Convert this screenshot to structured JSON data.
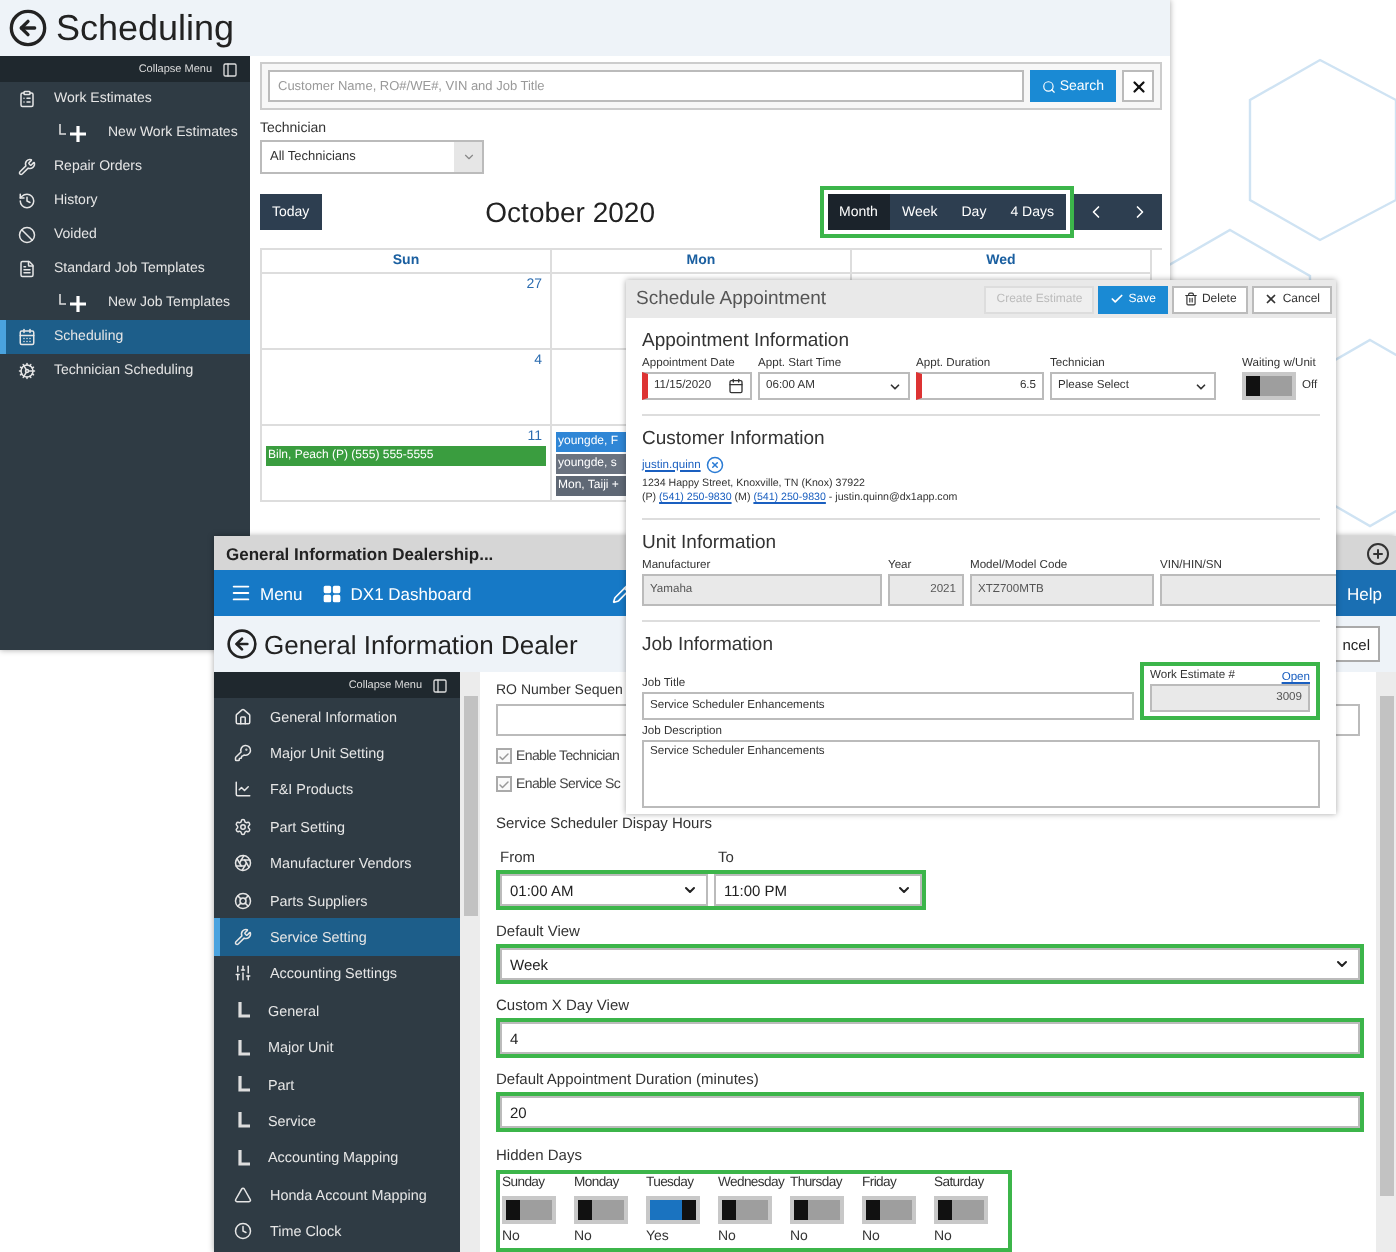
{
  "scheduling_window": {
    "title": "Scheduling",
    "sidebar": {
      "collapse_label": "Collapse Menu",
      "items": [
        {
          "label": "Work Estimates",
          "selected": false,
          "children": [
            {
              "label": "New Work Estimates",
              "selected": false
            }
          ]
        },
        {
          "label": "Repair Orders",
          "selected": false
        },
        {
          "label": "History",
          "selected": false
        },
        {
          "label": "Voided",
          "selected": false
        },
        {
          "label": "Standard Job Templates",
          "selected": false,
          "children": [
            {
              "label": "New Job Templates",
              "selected": false
            }
          ]
        },
        {
          "label": "Scheduling",
          "selected": true
        },
        {
          "label": "Technician Scheduling",
          "selected": false
        }
      ]
    },
    "search": {
      "placeholder": "Customer Name, RO#/WE#, VIN and Job Title",
      "button": "Search"
    },
    "technician": {
      "label": "Technician",
      "value": "All Technicians"
    },
    "today_button": "Today",
    "month_title": "October 2020",
    "view_switcher": {
      "highlighted": true,
      "views": [
        {
          "label": "Month",
          "selected": true
        },
        {
          "label": "Week",
          "selected": false
        },
        {
          "label": "Day",
          "selected": false
        },
        {
          "label": "4 Days",
          "selected": false
        }
      ]
    },
    "calendar": {
      "columns": [
        "Sun",
        "Mon",
        "Wed"
      ],
      "weeks": [
        {
          "sun": {
            "date": "27"
          }
        },
        {
          "sun": {
            "date": "4"
          }
        },
        {
          "sun": {
            "date": "11",
            "events": [
              {
                "text": "Biln, Peach (P) (555) 555-5555",
                "color": "#3a9d3f"
              }
            ]
          },
          "mon": {
            "events": [
              {
                "text": "youngde, F",
                "color": "#2f86d6"
              },
              {
                "text": "youngde, s",
                "color": "#6b7380"
              },
              {
                "text": "Mon, Taiji +",
                "color": "#5f6875"
              }
            ]
          }
        }
      ]
    }
  },
  "general_window": {
    "title": "General Information Dealership...",
    "nav": {
      "menu": "Menu",
      "dashboard": "DX1 Dashboard",
      "help": "Help"
    },
    "heading": "General Information Dealer",
    "cancel_button": "ncel",
    "sidebar": {
      "collapse_label": "Collapse Menu",
      "items": [
        {
          "label": "General Information",
          "selected": false
        },
        {
          "label": "Major Unit Setting",
          "selected": false
        },
        {
          "label": "F&I Products",
          "selected": false
        },
        {
          "label": "Part Setting",
          "selected": false
        },
        {
          "label": "Manufacturer Vendors",
          "selected": false
        },
        {
          "label": "Parts Suppliers",
          "selected": false
        },
        {
          "label": "Service Setting",
          "selected": true
        },
        {
          "label": "Accounting Settings",
          "selected": false,
          "children": [
            {
              "label": "General",
              "selected": false
            },
            {
              "label": "Major Unit",
              "selected": false
            },
            {
              "label": "Part",
              "selected": false
            },
            {
              "label": "Service",
              "selected": false
            },
            {
              "label": "Accounting Mapping",
              "selected": false
            }
          ]
        },
        {
          "label": "Honda Account Mapping",
          "selected": false
        },
        {
          "label": "Time Clock",
          "selected": false
        }
      ]
    },
    "settings": {
      "ro_label": "RO Number Sequen",
      "checkboxes": [
        {
          "label": "Enable Technician",
          "checked": true
        },
        {
          "label": "Enable Service Sc",
          "checked": true
        }
      ],
      "hours": {
        "label": "Service Scheduler Dispay Hours",
        "highlighted": true,
        "from": {
          "label": "From",
          "value": "01:00 AM"
        },
        "to": {
          "label": "To",
          "value": "11:00 PM"
        }
      },
      "default_view": {
        "label": "Default View",
        "value": "Week",
        "highlighted": true
      },
      "custom_days": {
        "label": "Custom X Day View",
        "value": "4",
        "highlighted": true
      },
      "duration": {
        "label": "Default Appointment Duration (minutes)",
        "value": "20",
        "highlighted": true
      },
      "hidden_days": {
        "label": "Hidden Days",
        "highlighted": true,
        "days": [
          {
            "label": "Sunday",
            "on": false,
            "state": "No"
          },
          {
            "label": "Monday",
            "on": false,
            "state": "No"
          },
          {
            "label": "Tuesday",
            "on": true,
            "state": "Yes"
          },
          {
            "label": "Wednesday",
            "on": false,
            "state": "No"
          },
          {
            "label": "Thursday",
            "on": false,
            "state": "No"
          },
          {
            "label": "Friday",
            "on": false,
            "state": "No"
          },
          {
            "label": "Saturday",
            "on": false,
            "state": "No"
          }
        ]
      }
    }
  },
  "appointment_dialog": {
    "title": "Schedule Appointment",
    "buttons": [
      {
        "label": "Create Estimate",
        "kind": "disabled"
      },
      {
        "label": "Save",
        "kind": "primary"
      },
      {
        "label": "Delete",
        "kind": "delete"
      },
      {
        "label": "Cancel",
        "kind": "cancel"
      }
    ],
    "appointment": {
      "heading": "Appointment Information",
      "fields": [
        {
          "label": "Appointment Date",
          "value": "11/15/2020",
          "kind": "date",
          "required": true
        },
        {
          "label": "Appt. Start Time",
          "value": "06:00 AM",
          "kind": "select",
          "required": false
        },
        {
          "label": "Appt. Duration",
          "value": "6.5",
          "kind": "number",
          "required": true
        },
        {
          "label": "Technician",
          "value": "Please Select",
          "kind": "select",
          "required": false
        }
      ],
      "waiting": {
        "label": "Waiting w/Unit",
        "on": false,
        "state": "Off"
      }
    },
    "customer": {
      "heading": "Customer Information",
      "name": "justin.quinn",
      "address": "1234 Happy Street, Knoxville, TN (Knox) 37922",
      "phones": [
        {
          "label": "(P)",
          "number": "(541) 250-9830"
        },
        {
          "label": "(M)",
          "number": "(541) 250-9830"
        }
      ],
      "email": "- justin.quinn@dx1app.com"
    },
    "unit": {
      "heading": "Unit Information",
      "fields": [
        {
          "label": "Manufacturer",
          "value": "Yamaha",
          "kind": "text"
        },
        {
          "label": "Year",
          "value": "2021",
          "kind": "number"
        },
        {
          "label": "Model/Model Code",
          "value": "XTZ700MTB",
          "kind": "text"
        },
        {
          "label": "VIN/HIN/SN",
          "kind": "text"
        }
      ]
    },
    "job": {
      "heading": "Job Information",
      "title_label": "Job Title",
      "title_value": "Service Scheduler Enhancements",
      "estimate": {
        "label": "Work Estimate #",
        "link": "Open",
        "value": "3009",
        "highlighted": true
      },
      "description_label": "Job Description",
      "description": "Service Scheduler Enhancements"
    }
  }
}
